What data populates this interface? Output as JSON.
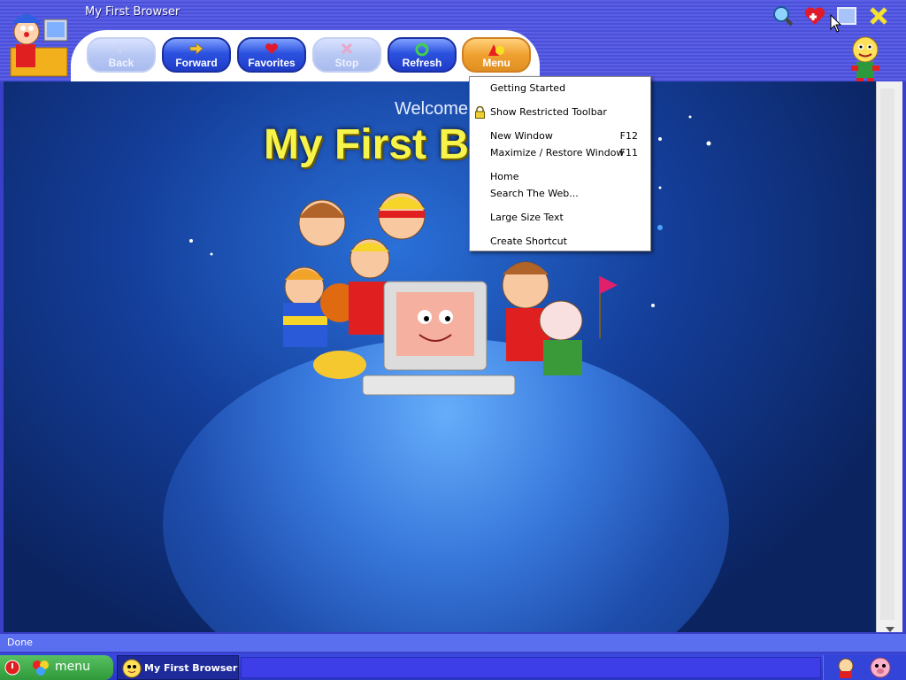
{
  "window": {
    "title": "My First Browser"
  },
  "toolbar": {
    "buttons": [
      {
        "label": "Back",
        "enabled": false,
        "icon": "arrow-left-icon"
      },
      {
        "label": "Forward",
        "enabled": true,
        "icon": "arrow-right-icon"
      },
      {
        "label": "Favorites",
        "enabled": true,
        "icon": "heart-icon"
      },
      {
        "label": "Stop",
        "enabled": false,
        "icon": "stop-x-icon"
      },
      {
        "label": "Refresh",
        "enabled": true,
        "icon": "refresh-icon"
      },
      {
        "label": "Menu",
        "enabled": true,
        "icon": "menu-shapes-icon"
      }
    ]
  },
  "page": {
    "welcome": "Welcome",
    "heading": "My First B"
  },
  "menu": {
    "items": [
      {
        "label": "Getting Started",
        "shortcut": ""
      },
      {
        "label": "Show Restricted Toolbar",
        "shortcut": "",
        "icon": "padlock-icon"
      },
      {
        "label": "New Window",
        "shortcut": "F12"
      },
      {
        "label": "Maximize / Restore Window",
        "shortcut": "F11"
      },
      {
        "label": "Home",
        "shortcut": ""
      },
      {
        "label": "Search The Web...",
        "shortcut": ""
      },
      {
        "label": "Large Size Text",
        "shortcut": ""
      },
      {
        "label": "Create Shortcut",
        "shortcut": ""
      }
    ]
  },
  "status": {
    "text": "Done"
  },
  "taskbar": {
    "start_label": "menu",
    "task_label": "My First Browser"
  },
  "colors": {
    "title_bg": "#4b50d8",
    "heading_yellow": "#f6f34a",
    "content_blue": "#143e9a"
  }
}
